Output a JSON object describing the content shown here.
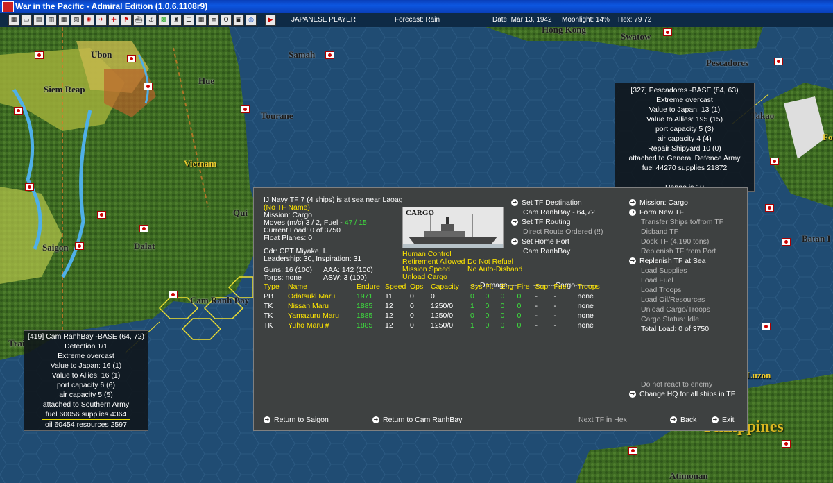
{
  "window": {
    "title": "War in the Pacific - Admiral Edition (1.0.6.1108r9)"
  },
  "toolbar": {
    "player": "JAPANESE PLAYER",
    "forecast": "Forecast: Rain",
    "date": "Date: Mar 13, 1942",
    "moonlight": "Moonlight: 14%",
    "hex": "Hex: 79 72"
  },
  "map_labels": [
    {
      "name": "Ubon"
    },
    {
      "name": "Siem Reap"
    },
    {
      "name": "Hue"
    },
    {
      "name": "Tourane"
    },
    {
      "name": "Vietnam"
    },
    {
      "name": "Samah"
    },
    {
      "name": "Hong Kong"
    },
    {
      "name": "Swatow"
    },
    {
      "name": "Pescadores"
    },
    {
      "name": "Takao"
    },
    {
      "name": "Saigon"
    },
    {
      "name": "Dalat"
    },
    {
      "name": "Qui"
    },
    {
      "name": "Cam Ranh Bay"
    },
    {
      "name": "Batan I"
    },
    {
      "name": "Luzon"
    },
    {
      "name": "Philippines"
    },
    {
      "name": "Atimonan"
    },
    {
      "name": "Fo"
    },
    {
      "name": "Trai"
    }
  ],
  "pescadores_popup": {
    "lines": [
      "[327] Pescadores -BASE (84, 63)",
      "Extreme overcast",
      "Value to Japan: 13 (1)",
      "Value to Allies: 195 (15)",
      "port capacity 5 (3)",
      "air capacity 4 (4)",
      "Repair Shipyard  10 (0)",
      "attached to General Defence Army",
      "fuel 44270  supplies 21872"
    ],
    "range": "Range is 10"
  },
  "camranh_popup": {
    "lines": [
      "[419] Cam RanhBay  -BASE (64, 72)",
      "Detection 1/1",
      "Extreme overcast",
      "Value to Japan: 16 (1)",
      "Value to Allies: 16 (1)",
      "port capacity 6 (6)",
      "air capacity 5 (5)",
      "attached to Southern Army",
      "fuel 60056  supplies 4364"
    ],
    "highlight": "oil 60454  resources 2597"
  },
  "tf": {
    "header": "IJ Navy TF 7 (4 ships) is at sea near Laoag",
    "name": "(No TF Name)",
    "mission": "Mission: Cargo",
    "moves": "Moves (m/c) 3 / 2, Fuel -",
    "fuel_value": "47 / 15",
    "current_load": "Current Load: 0 of 3750",
    "float_planes": "Float Planes: 0",
    "cdr": "Cdr: CPT  Miyake, I.",
    "leadership": "Leadership: 30, Inspiration: 31",
    "guns": "Guns: 16 (100)",
    "aaa": "AAA: 142 (100)",
    "torps": "Torps: none",
    "asw": "ASW: 3 (100)",
    "image_label": "CARGO",
    "status_left": [
      "Human Control",
      "Retirement Allowed",
      "Mission Speed",
      "Unload Cargo"
    ],
    "status_right": [
      "Do Not Refuel",
      "No Auto-Disband"
    ]
  },
  "mid_menu": {
    "set_destination": "Set TF Destination",
    "destination": "Cam RanhBay - 64,72",
    "set_routing": "Set TF Routing",
    "direct_route": "Direct Route Ordered (!!)",
    "set_home": "Set Home Port",
    "home": "Cam RanhBay"
  },
  "right_menu": {
    "mission": "Mission: Cargo",
    "form_new": "Form New TF",
    "transfer": "Transfer Ships to/from TF",
    "disband": "Disband TF",
    "dock": "Dock TF (4,190 tons)",
    "replenish_port": "Replenish TF from Port",
    "replenish_sea": "Replenish TF at Sea",
    "load_supplies": "Load Supplies",
    "load_fuel": "Load Fuel",
    "load_troops": "Load Troops",
    "load_oil": "Load Oil/Resources",
    "unload": "Unload Cargo/Troops",
    "cargo_status": "Cargo Status: Idle",
    "total_load": "Total Load: 0 of 3750",
    "no_react": "Do not react to enemy",
    "change_hq": "Change HQ for all ships in TF"
  },
  "table": {
    "group_damage": "----Damage----",
    "group_cargo": "---------Cargo--------",
    "headers": [
      "Type",
      "Name",
      "Endure",
      "Speed",
      "Ops",
      "Capacity",
      "Sys",
      "Flt",
      "Eng",
      "Fire",
      "Sup",
      "Fuel",
      "Troops"
    ],
    "rows": [
      {
        "type": "PB",
        "name": "Odatsuki Maru",
        "endure": "1971",
        "speed": "11",
        "ops": "0",
        "capacity": "0",
        "sys": "0",
        "flt": "0",
        "eng": "0",
        "fire": "0",
        "sup": "-",
        "fuel": "-",
        "troops": "none"
      },
      {
        "type": "TK",
        "name": "Nissan Maru",
        "endure": "1885",
        "speed": "12",
        "ops": "0",
        "capacity": "1250/0",
        "sys": "1",
        "flt": "0",
        "eng": "0",
        "fire": "0",
        "sup": "-",
        "fuel": "-",
        "troops": "none"
      },
      {
        "type": "TK",
        "name": "Yamazuru Maru",
        "endure": "1885",
        "speed": "12",
        "ops": "0",
        "capacity": "1250/0",
        "sys": "0",
        "flt": "0",
        "eng": "0",
        "fire": "0",
        "sup": "-",
        "fuel": "-",
        "troops": "none"
      },
      {
        "type": "TK",
        "name": "Yuho Maru #",
        "endure": "1885",
        "speed": "12",
        "ops": "0",
        "capacity": "1250/0",
        "sys": "1",
        "flt": "0",
        "eng": "0",
        "fire": "0",
        "sup": "-",
        "fuel": "-",
        "troops": "none"
      }
    ]
  },
  "bottom": {
    "return_saigon": "Return to Saigon",
    "return_camranh": "Return to Cam RanhBay",
    "next_tf": "Next TF in Hex",
    "back": "Back",
    "exit": "Exit"
  }
}
